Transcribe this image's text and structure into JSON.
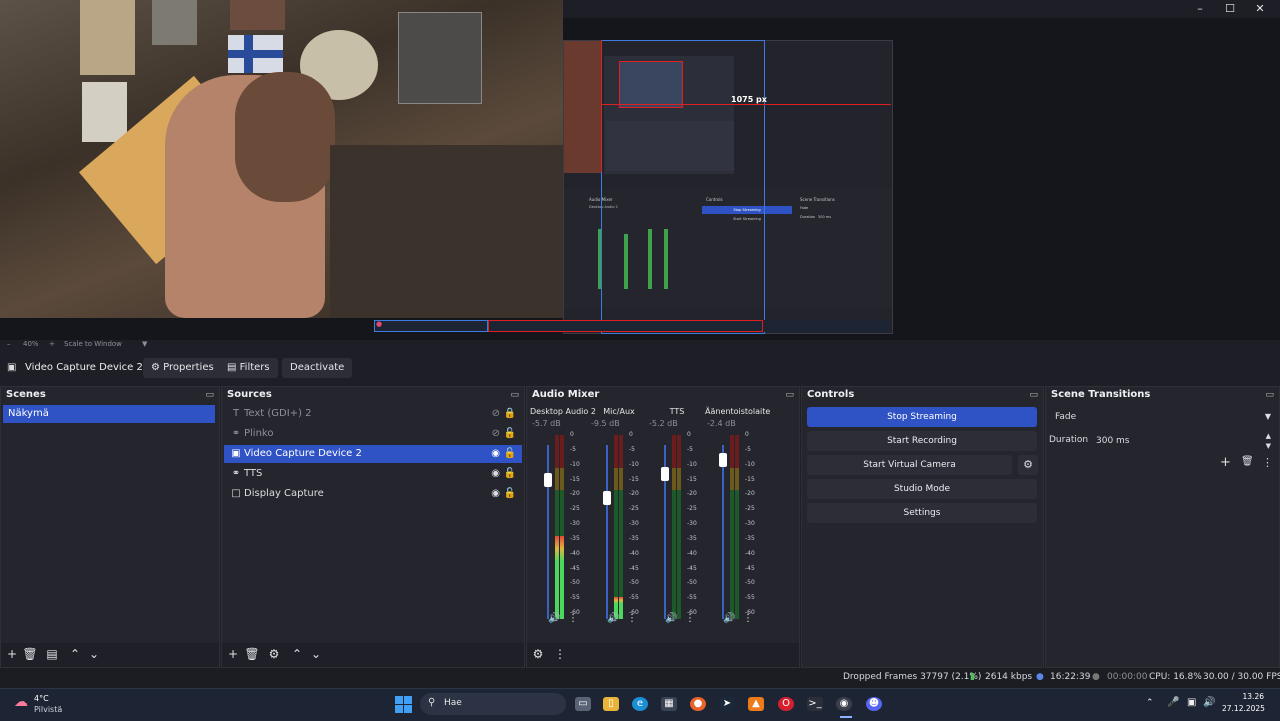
{
  "window": {
    "minimize": "–",
    "maximize": "☐",
    "close": "✕"
  },
  "preview": {
    "measure_label": "1075 px",
    "nested": {
      "audio_mixer": "Audio Mixer",
      "desktop_audio": "Desktop Audio 2",
      "controls": "Controls",
      "stop_streaming": "Stop Streaming",
      "start_streaming": "Start Streaming",
      "scene_transitions": "Scene Transitions",
      "fade": "Fade",
      "duration": "Duration",
      "duration_value": "300 ms"
    }
  },
  "zoom": {
    "minus": "–",
    "percent": "40%",
    "plus": "+",
    "mode": "Scale to Window"
  },
  "context": {
    "source_name": "Video Capture Device 2",
    "properties": "Properties",
    "filters": "Filters",
    "deactivate": "Deactivate"
  },
  "scenes": {
    "title": "Scenes",
    "items": [
      {
        "label": "Näkymä",
        "selected": true
      }
    ]
  },
  "sources": {
    "title": "Sources",
    "items": [
      {
        "label": "Text (GDI+) 2",
        "icon": "text-icon",
        "visible": false,
        "dim": true
      },
      {
        "label": "Plinko",
        "icon": "browser-icon",
        "visible": false,
        "dim": true
      },
      {
        "label": "Video Capture Device 2",
        "icon": "camera-icon",
        "visible": true,
        "selected": true
      },
      {
        "label": "TTS",
        "icon": "browser-icon",
        "visible": true
      },
      {
        "label": "Display Capture",
        "icon": "monitor-icon",
        "visible": true
      }
    ]
  },
  "mixer": {
    "title": "Audio Mixer",
    "scale": [
      "0",
      "-5",
      "-10",
      "-15",
      "-20",
      "-25",
      "-30",
      "-35",
      "-40",
      "-45",
      "-50",
      "-55",
      "-60"
    ],
    "channels": [
      {
        "name": "Desktop Audio 2",
        "db": "-5.7 dB",
        "level": 0.45
      },
      {
        "name": "Mic/Aux",
        "db": "-9.5 dB",
        "level": 0.12
      },
      {
        "name": "TTS",
        "db": "-5.2 dB",
        "level": 0
      },
      {
        "name": "Äänentoistolaite",
        "db": "-2.4 dB",
        "level": 0
      }
    ]
  },
  "controls": {
    "title": "Controls",
    "stop_streaming": "Stop Streaming",
    "start_recording": "Start Recording",
    "start_virtual_camera": "Start Virtual Camera",
    "studio_mode": "Studio Mode",
    "settings": "Settings"
  },
  "transitions": {
    "title": "Scene Transitions",
    "selected": "Fade",
    "duration_label": "Duration",
    "duration_value": "300 ms"
  },
  "status": {
    "dropped_frames": "Dropped Frames 37797 (2.1%)",
    "bitrate": "2614 kbps",
    "stream_time": "16:22:39",
    "rec_time": "00:00:00",
    "cpu": "CPU: 16.8%",
    "fps": "30.00 / 30.00 FPS"
  },
  "taskbar": {
    "weather_temp": "4°C",
    "weather_desc": "Pilvistä",
    "search_placeholder": "Hae",
    "time": "13.26",
    "date": "27.12.2025"
  },
  "colors": {
    "accent": "#2f53c5",
    "dock_bg": "#24252d",
    "red_guide": "#e02020"
  }
}
